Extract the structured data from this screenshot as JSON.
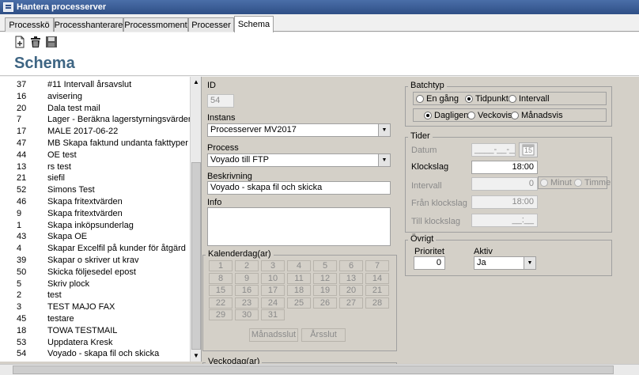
{
  "window": {
    "title": "Hantera processerver"
  },
  "tabs": [
    {
      "label": "Processkö"
    },
    {
      "label": "Processhanterare"
    },
    {
      "label": "Processmoment"
    },
    {
      "label": "Processer"
    },
    {
      "label": "Schema"
    }
  ],
  "toolbar": {
    "icons": [
      "new-document-icon",
      "trash-icon",
      "save-icon"
    ]
  },
  "page": {
    "title": "Schema"
  },
  "list": {
    "items": [
      {
        "id": "37",
        "name": "#11 Intervall årsavslut"
      },
      {
        "id": "16",
        "name": "avisering"
      },
      {
        "id": "20",
        "name": "Dala test mail"
      },
      {
        "id": "7",
        "name": "Lager - Beräkna lagerstyrningsvärden"
      },
      {
        "id": "17",
        "name": "MALE 2017-06-22"
      },
      {
        "id": "47",
        "name": "MB Skapa faktund undanta fakttyper"
      },
      {
        "id": "44",
        "name": "OE test"
      },
      {
        "id": "13",
        "name": "rs test"
      },
      {
        "id": "21",
        "name": "siefil"
      },
      {
        "id": "52",
        "name": "Simons Test"
      },
      {
        "id": "46",
        "name": "Skapa fritextvärden"
      },
      {
        "id": "9",
        "name": "Skapa fritextvärden"
      },
      {
        "id": "1",
        "name": "Skapa inköpsunderlag"
      },
      {
        "id": "43",
        "name": "Skapa OE"
      },
      {
        "id": "4",
        "name": "Skapar Excelfil på kunder för åtgärd"
      },
      {
        "id": "39",
        "name": "Skapar o skriver ut krav"
      },
      {
        "id": "50",
        "name": "Skicka följesedel epost"
      },
      {
        "id": "5",
        "name": "Skriv plock"
      },
      {
        "id": "2",
        "name": "test"
      },
      {
        "id": "3",
        "name": "TEST MAJO FAX"
      },
      {
        "id": "45",
        "name": "testare"
      },
      {
        "id": "18",
        "name": "TOWA TESTMAIL"
      },
      {
        "id": "53",
        "name": "Uppdatera Kresk"
      },
      {
        "id": "54",
        "name": "Voyado - skapa fil och skicka"
      }
    ]
  },
  "form": {
    "id_label": "ID",
    "id_value": "54",
    "instans_label": "Instans",
    "instans_value": "Processerver MV2017",
    "process_label": "Process",
    "process_value": "Voyado till FTP",
    "beskrivning_label": "Beskrivning",
    "beskrivning_value": "Voyado - skapa fil och skicka",
    "info_label": "Info",
    "info_value": ""
  },
  "kalender": {
    "title": "Kalenderdag(ar)",
    "days": [
      "1",
      "2",
      "3",
      "4",
      "5",
      "6",
      "7",
      "8",
      "9",
      "10",
      "11",
      "12",
      "13",
      "14",
      "15",
      "16",
      "17",
      "18",
      "19",
      "20",
      "21",
      "22",
      "23",
      "24",
      "25",
      "26",
      "27",
      "28",
      "29",
      "30",
      "31"
    ],
    "manadsslut": "Månadsslut",
    "arsslut": "Årsslut"
  },
  "veckodag": {
    "title": "Veckodag(ar)"
  },
  "batchtyp": {
    "title": "Batchtyp",
    "row1": [
      {
        "label": "En gång",
        "checked": false
      },
      {
        "label": "Tidpunkt",
        "checked": true
      },
      {
        "label": "Intervall",
        "checked": false
      }
    ],
    "row2": [
      {
        "label": "Dagligen",
        "checked": true
      },
      {
        "label": "Veckovis",
        "checked": false
      },
      {
        "label": "Månadsvis",
        "checked": false
      }
    ]
  },
  "tider": {
    "title": "Tider",
    "datum_label": "Datum",
    "datum_value": "____-__-__",
    "calendar_day": "15",
    "klockslag_label": "Klockslag",
    "klockslag_value": "18:00",
    "intervall_label": "Intervall",
    "intervall_value": "0",
    "minut_label": "Minut",
    "timme_label": "Timme",
    "fran_label": "Från klockslag",
    "fran_value": "18:00",
    "till_label": "Till klockslag",
    "till_value": "__:__"
  },
  "ovrigt": {
    "title": "Övrigt",
    "prioritet_label": "Prioritet",
    "prioritet_value": "0",
    "aktiv_label": "Aktiv",
    "aktiv_value": "Ja"
  }
}
